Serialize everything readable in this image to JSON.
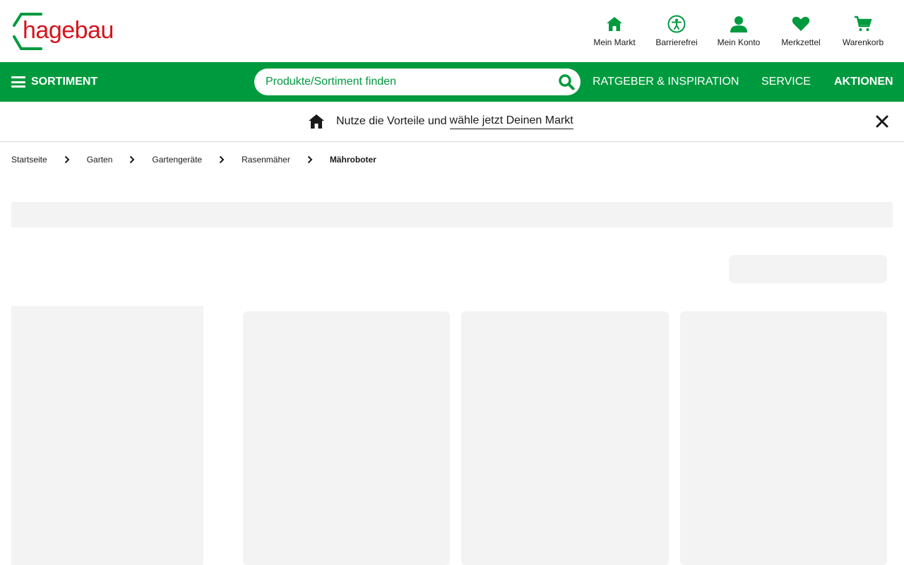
{
  "brand": {
    "logo_text": "hagebau",
    "logo_color": "#d4141c",
    "accent": "#009a3e"
  },
  "header": {
    "icons": [
      {
        "name": "home-icon",
        "label": "Mein Markt"
      },
      {
        "name": "accessibility-icon",
        "label": "Barrierefrei"
      },
      {
        "name": "user-icon",
        "label": "Mein Konto"
      },
      {
        "name": "heart-icon",
        "label": "Merkzettel"
      },
      {
        "name": "cart-icon",
        "label": "Warenkorb"
      }
    ]
  },
  "nav": {
    "sortiment_label": "SORTIMENT",
    "search_placeholder": "Produkte/Sortiment finden",
    "links": [
      "RATGEBER & INSPIRATION",
      "SERVICE",
      "AKTIONEN"
    ]
  },
  "banner": {
    "text_prefix": "Nutze die Vorteile und",
    "link_text": "wähle jetzt Deinen Markt"
  },
  "breadcrumb": [
    "Startseite",
    "Garten",
    "Gartengeräte",
    "Rasenmäher",
    "Mähroboter"
  ]
}
